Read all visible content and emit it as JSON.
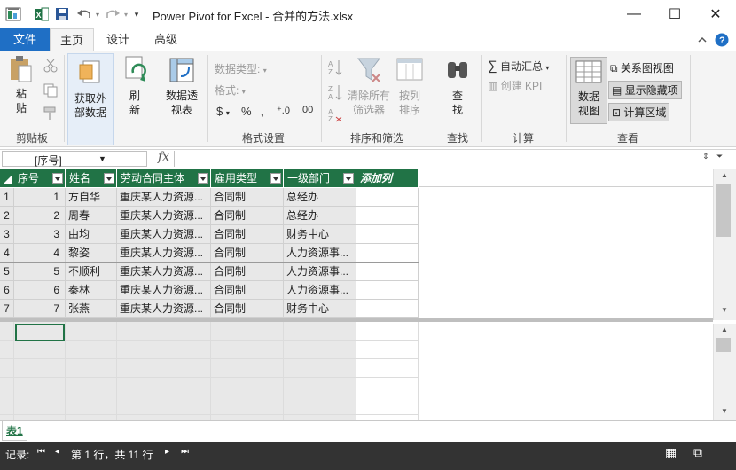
{
  "window": {
    "title": "Power Pivot for Excel - 合并的方法.xlsx",
    "controls": {
      "minimize": "—",
      "maximize": "☐",
      "close": "✕"
    }
  },
  "tabs": {
    "file": "文件",
    "home": "主页",
    "design": "设计",
    "advanced": "高级"
  },
  "ribbon": {
    "clipboard": {
      "paste": "粘贴",
      "label": "剪贴板"
    },
    "get_data": "获取外部数据",
    "refresh": "刷新",
    "pivot": "数据透视表",
    "format": {
      "data_type": "数据类型:",
      "format": "格式:",
      "label": "格式设置"
    },
    "sort_filter": {
      "clear_all": "清除所有筛选器",
      "sort_by": "按列排序",
      "label": "排序和筛选"
    },
    "find": {
      "button": "查找",
      "label": "查找"
    },
    "calculations": {
      "autosum": "自动汇总",
      "create_kpi": "创建 KPI",
      "label": "计算"
    },
    "view": {
      "data_view": "数据视图",
      "diagram_view": "关系图视图",
      "show_hidden": "显示隐藏项",
      "calc_area": "计算区域",
      "label": "查看"
    }
  },
  "formula_bar": {
    "name_box": "[序号]",
    "fx": "fx",
    "formula": ""
  },
  "table": {
    "columns": [
      "序号",
      "姓名",
      "劳动合同主体",
      "雇用类型",
      "一级部门",
      "添加列"
    ],
    "row_numbers": [
      "1",
      "2",
      "3",
      "4",
      "5",
      "6",
      "7"
    ],
    "rows": [
      [
        "1",
        "方自华",
        "重庆某人力资源...",
        "合同制",
        "总经办"
      ],
      [
        "2",
        "周春",
        "重庆某人力资源...",
        "合同制",
        "总经办"
      ],
      [
        "3",
        "由均",
        "重庆某人力资源...",
        "合同制",
        "财务中心"
      ],
      [
        "4",
        "黎姿",
        "重庆某人力资源...",
        "合同制",
        "人力资源事..."
      ],
      [
        "5",
        "不顺利",
        "重庆某人力资源...",
        "合同制",
        "人力资源事..."
      ],
      [
        "6",
        "秦林",
        "重庆某人力资源...",
        "合同制",
        "人力资源事..."
      ],
      [
        "7",
        "张燕",
        "重庆某人力资源...",
        "合同制",
        "财务中心"
      ]
    ]
  },
  "sheet": {
    "tab": "表1"
  },
  "status": {
    "record_label": "记录:",
    "record_text": "第 1 行，共 11 行"
  }
}
